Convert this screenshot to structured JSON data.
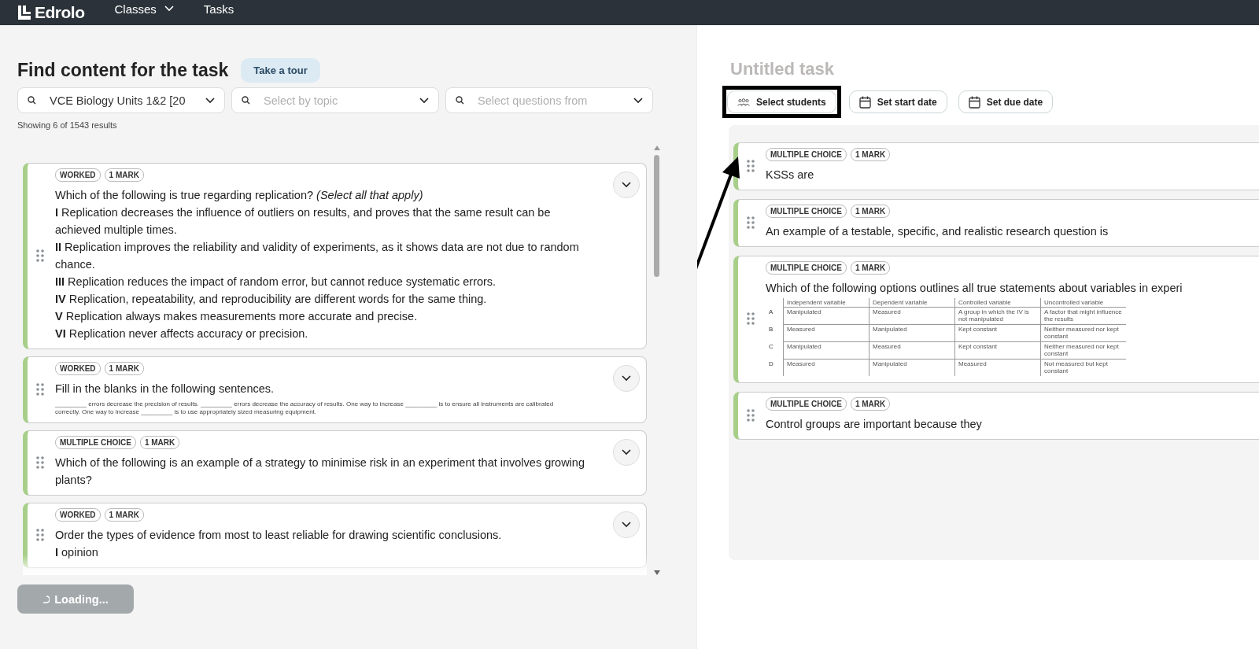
{
  "nav": {
    "logo": "Edrolo",
    "items": [
      {
        "label": "Classes",
        "dropdown": true
      },
      {
        "label": "Tasks",
        "dropdown": false
      }
    ]
  },
  "finder": {
    "title": "Find content for the task",
    "tour_button": "Take a tour",
    "filters": [
      {
        "value": "VCE Biology Units 1&2 [20"
      },
      {
        "placeholder": "Select by topic"
      },
      {
        "placeholder": "Select questions from"
      }
    ],
    "result_count": "Showing 6 of 1543 results",
    "questions": [
      {
        "tags": [
          "WORKED",
          "1 MARK"
        ],
        "kind": "text",
        "lines": [
          "Which of the following is true regarding replication? *(Select all that apply)*",
          "**I** Replication decreases the influence of outliers on results, and proves that the same result can be achieved multiple times.",
          "**II** Replication improves the reliability and validity of experiments, as it shows data are not due to random chance.",
          "**III** Replication reduces the impact of random error, but cannot reduce systematic errors.",
          "**IV** Replication, repeatability, and reproducibility are different words for the same thing.",
          "**V** Replication always makes measurements more accurate and precise.",
          "**VI** Replication never affects accuracy or precision."
        ]
      },
      {
        "tags": [
          "WORKED",
          "1 MARK"
        ],
        "kind": "blanks",
        "lines": [
          "Fill in the blanks in the following sentences."
        ],
        "small_text": "_________ errors decrease the precision of results. _________ errors decrease the accuracy of results. One way to increase _________ is to ensure all instruments are calibrated correctly. One way to increase _________ is to use appropriately sized measuring equipment."
      },
      {
        "tags": [
          "MULTIPLE CHOICE",
          "1 MARK"
        ],
        "kind": "text",
        "lines": [
          "Which of the following is an example of a strategy to minimise risk in an experiment that involves growing plants?"
        ]
      },
      {
        "tags": [
          "WORKED",
          "1 MARK"
        ],
        "kind": "text",
        "lines": [
          "Order the types of evidence from most to least reliable for drawing scientific conclusions.",
          "**I** opinion"
        ]
      }
    ],
    "loading_button": "Loading..."
  },
  "task": {
    "title_placeholder": "Untitled task",
    "actions": [
      {
        "label": "Select students",
        "kind": "people",
        "highlighted": true
      },
      {
        "label": "Set start date",
        "kind": "calendar",
        "highlighted": false
      },
      {
        "label": "Set due date",
        "kind": "calendar",
        "highlighted": false
      }
    ],
    "questions": [
      {
        "tags": [
          "MULTIPLE CHOICE",
          "1 MARK"
        ],
        "kind": "text",
        "lines": [
          "KSSs are"
        ]
      },
      {
        "tags": [
          "MULTIPLE CHOICE",
          "1 MARK"
        ],
        "kind": "text",
        "lines": [
          "An example of a testable, specific, and realistic research question is"
        ]
      },
      {
        "tags": [
          "MULTIPLE CHOICE",
          "1 MARK"
        ],
        "kind": "table",
        "lines": [
          "Which of the following options outlines all true statements about variables in experi"
        ],
        "table": {
          "columns": [
            "Independent variable",
            "Dependent variable",
            "Controlled variable",
            "Uncontrolled variable"
          ],
          "rows": [
            {
              "label": "A",
              "cells": [
                "Manipulated",
                "Measured",
                "A group in which the IV is not manipulated",
                "A factor that might influence the results"
              ]
            },
            {
              "label": "B",
              "cells": [
                "Measured",
                "Manipulated",
                "Kept constant",
                "Neither measured nor kept constant"
              ]
            },
            {
              "label": "C",
              "cells": [
                "Manipulated",
                "Measured",
                "Kept constant",
                "Neither measured nor kept constant"
              ]
            },
            {
              "label": "D",
              "cells": [
                "Measured",
                "Manipulated",
                "Measured",
                "Not measured but kept constant"
              ]
            }
          ]
        }
      },
      {
        "tags": [
          "MULTIPLE CHOICE",
          "1 MARK"
        ],
        "kind": "text",
        "lines": [
          "Control groups are important because they"
        ]
      }
    ]
  }
}
